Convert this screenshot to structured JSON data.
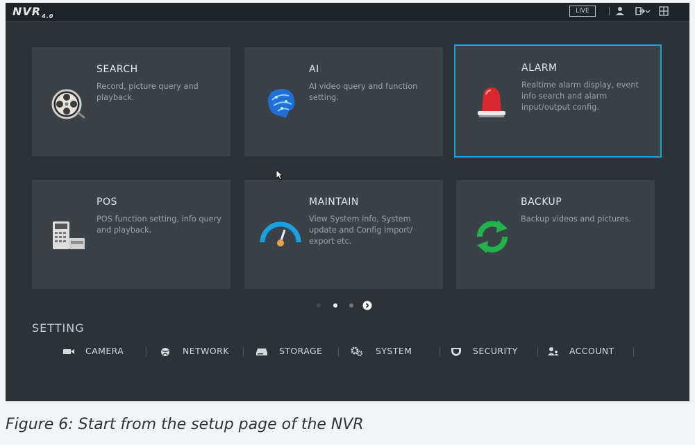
{
  "topbar": {
    "logo_text": "NVR",
    "logo_version": "4.0",
    "live_label": "LIVE",
    "icons": [
      "user-icon",
      "logout-icon",
      "layout-icon"
    ]
  },
  "tiles": [
    {
      "title": "SEARCH",
      "desc": "Record, picture query and playback.",
      "icon": "film-reel-icon",
      "selected": false
    },
    {
      "title": "AI",
      "desc": "AI video query and function setting.",
      "icon": "ai-brain-icon",
      "selected": false
    },
    {
      "title": "ALARM",
      "desc": "Realtime alarm display, event info search and alarm input/output config.",
      "icon": "alarm-light-icon",
      "selected": true
    },
    {
      "title": "POS",
      "desc": "POS function setting, info query and playback.",
      "icon": "pos-terminal-icon",
      "selected": false
    },
    {
      "title": "MAINTAIN",
      "desc": "View System info, System update and Config import/ export etc.",
      "icon": "gauge-icon",
      "selected": false
    },
    {
      "title": "BACKUP",
      "desc": "Backup videos and pictures.",
      "icon": "refresh-arrows-icon",
      "selected": false
    }
  ],
  "pager": {
    "pages": 3,
    "current": 1
  },
  "setting": {
    "label": "SETTING",
    "items": [
      {
        "label": "CAMERA",
        "icon": "camera-icon"
      },
      {
        "label": "NETWORK",
        "icon": "globe-icon"
      },
      {
        "label": "STORAGE",
        "icon": "hard-drive-icon"
      },
      {
        "label": "SYSTEM",
        "icon": "gears-icon"
      },
      {
        "label": "SECURITY",
        "icon": "shield-icon"
      },
      {
        "label": "ACCOUNT",
        "icon": "users-icon"
      }
    ]
  },
  "caption": "Figure 6: Start from the setup page of the NVR",
  "colors": {
    "accent": "#1aa1e0",
    "tile_bg": "#3a4248",
    "screen_bg": "#2c3338"
  }
}
